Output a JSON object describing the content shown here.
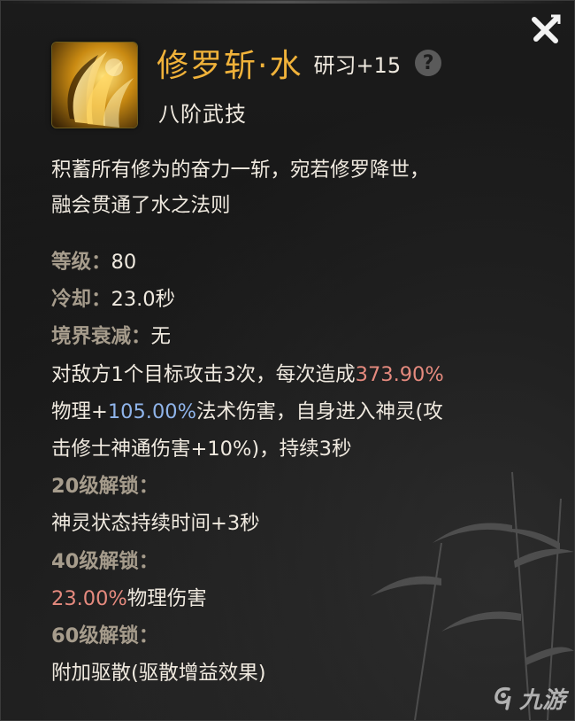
{
  "skill": {
    "name": "修罗斩·水",
    "study": "研习+15",
    "tier": "八阶武技",
    "description": [
      "积蓄所有修为的奋力一斩，宛若修罗降世，",
      "融会贯通了水之法则"
    ]
  },
  "help_label": "?",
  "stats": {
    "level_label": "等级：",
    "level_value": "80",
    "cooldown_label": "冷却：",
    "cooldown_value": "23.0秒",
    "realm_label": "境界衰减：",
    "realm_value": "无"
  },
  "effect": {
    "line1_pre": "对敌方1个目标攻击3次，每次造成",
    "physical_pct": "373.90%",
    "line2_pre": "物理+",
    "magic_pct": "105.00%",
    "line2_post": "法术伤害，自身进入神灵(攻",
    "line3": "击修士神通伤害+10%)，持续3秒"
  },
  "unlocks": [
    {
      "label": "20级解锁：",
      "text_pre": "",
      "highlight": "",
      "text": "神灵状态持续时间+3秒"
    },
    {
      "label": "40级解锁：",
      "text_pre": "",
      "highlight": "23.00%",
      "text": "物理伤害"
    },
    {
      "label": "60级解锁：",
      "text_pre": "",
      "highlight": "",
      "text": "附加驱散(驱散增益效果)"
    }
  ],
  "watermark": {
    "text": "九游",
    "icon": "nine-game-logo-icon"
  },
  "colors": {
    "title_gold": "#f0b23a",
    "label_gray": "#a69c8c",
    "value_red": "#e58a7e",
    "value_blue": "#8fb4ea"
  }
}
